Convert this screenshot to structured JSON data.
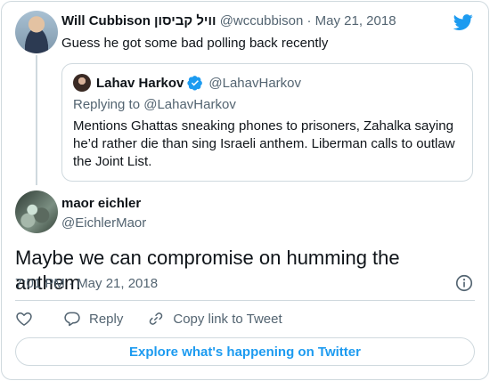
{
  "parent": {
    "name": "Will Cubbison וויל קביסון",
    "handle": "@wccubbison",
    "sep": "·",
    "date": "May 21, 2018",
    "text": "Guess he got some bad polling back recently"
  },
  "quote": {
    "name": "Lahav Harkov",
    "handle": "@LahavHarkov",
    "replying_to": "Replying to @LahavHarkov",
    "text": "Mentions Ghattas sneaking phones to prisoners, Zahalka saying he’d rather die than sing Israeli anthem. Liberman calls to outlaw the Joint List."
  },
  "main": {
    "name": "maor eichler",
    "handle": "@EichlerMaor",
    "text": "Maybe we can compromise on humming the anthem",
    "time": "7:01 PM · May 21, 2018"
  },
  "actions": {
    "reply_label": "Reply",
    "copy_label": "Copy link to Tweet"
  },
  "explore_label": "Explore what's happening on Twitter",
  "icons": {
    "logo": "twitter-bird-icon",
    "verified": "verified-badge-icon",
    "info": "info-icon",
    "like": "heart-icon",
    "reply": "reply-bubble-icon",
    "link": "link-icon"
  },
  "colors": {
    "accent": "#1d9bf0",
    "text": "#0f1419",
    "muted": "#536471",
    "border": "#cfd9de"
  }
}
